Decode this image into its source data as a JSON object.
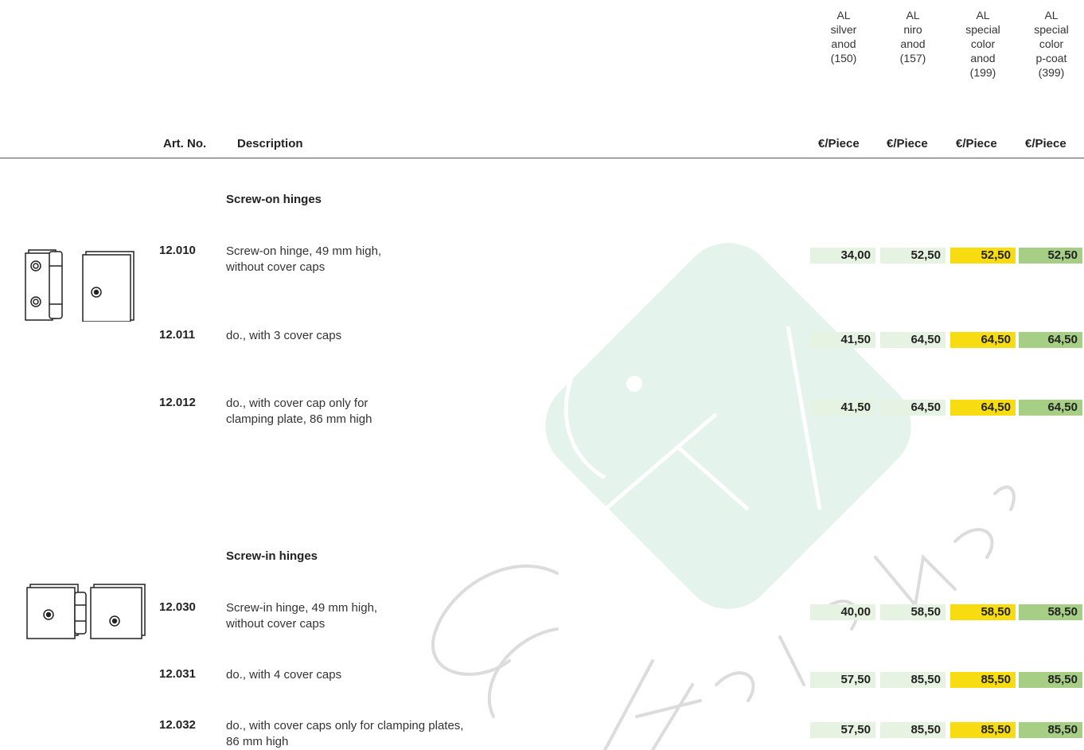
{
  "columns": [
    {
      "head": "AL\nsilver\nanod\n(150)"
    },
    {
      "head": "AL\nniro\nanod\n(157)"
    },
    {
      "head": "AL\nspecial\ncolor\nanod\n(199)"
    },
    {
      "head": "AL\nspecial\ncolor\np-coat\n(399)"
    }
  ],
  "header": {
    "art_no": "Art. No.",
    "description": "Description",
    "unit": "€/Piece"
  },
  "sections": [
    {
      "title": "Screw-on hinges",
      "image_icon": "screw-on-hinge-icon",
      "items": [
        {
          "art": "12.010",
          "desc": "Screw-on hinge, 49 mm high,\nwithout cover caps",
          "prices": [
            "34,00",
            "52,50",
            "52,50",
            "52,50"
          ]
        },
        {
          "art": "12.011",
          "desc": "do., with 3 cover caps",
          "prices": [
            "41,50",
            "64,50",
            "64,50",
            "64,50"
          ]
        },
        {
          "art": "12.012",
          "desc": "do., with cover cap only for\nclamping plate, 86 mm high",
          "prices": [
            "41,50",
            "64,50",
            "64,50",
            "64,50"
          ]
        }
      ]
    },
    {
      "title": "Screw-in hinges",
      "image_icon": "screw-in-hinge-icon",
      "items": [
        {
          "art": "12.030",
          "desc": "Screw-in hinge, 49 mm high,\nwithout cover caps",
          "prices": [
            "40,00",
            "58,50",
            "58,50",
            "58,50"
          ]
        },
        {
          "art": "12.031",
          "desc": "do., with 4 cover caps",
          "prices": [
            "57,50",
            "85,50",
            "85,50",
            "85,50"
          ]
        },
        {
          "art": "12.032",
          "desc": "do., with cover caps only for clamping plates,\n86 mm high",
          "prices": [
            "57,50",
            "85,50",
            "85,50",
            "85,50"
          ]
        }
      ]
    }
  ],
  "watermark_text": "Hardware",
  "colors": {
    "price_light": "#e6f2e2",
    "price_yellow": "#f7dc12",
    "price_green": "#a6cf85",
    "watermark_mint": "#e4f3eb"
  }
}
